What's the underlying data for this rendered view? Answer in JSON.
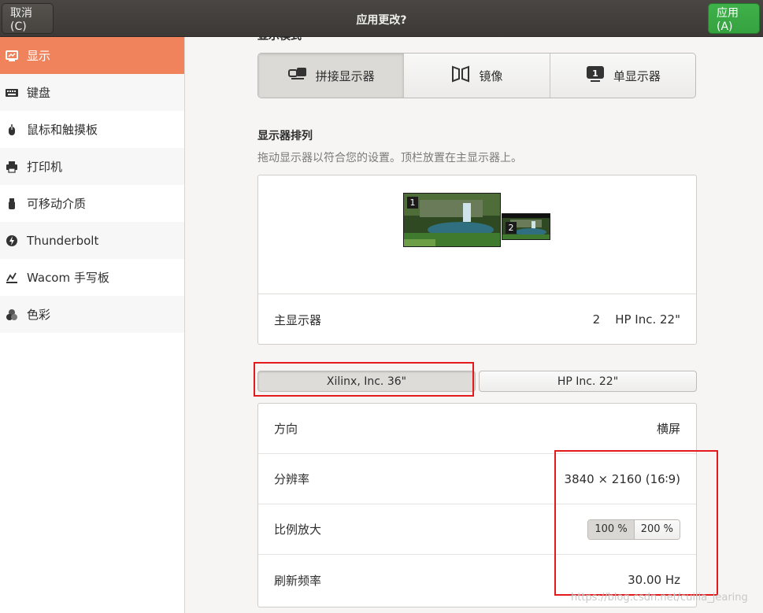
{
  "header": {
    "cancel_label": "取消(C)",
    "title": "应用更改?",
    "apply_label": "应用(A)"
  },
  "sidebar": {
    "items": [
      {
        "label": "显示",
        "icon": "display-icon"
      },
      {
        "label": "键盘",
        "icon": "keyboard-icon"
      },
      {
        "label": "鼠标和触摸板",
        "icon": "mouse-icon"
      },
      {
        "label": "打印机",
        "icon": "printer-icon"
      },
      {
        "label": "可移动介质",
        "icon": "removable-media-icon"
      },
      {
        "label": "Thunderbolt",
        "icon": "thunderbolt-icon"
      },
      {
        "label": "Wacom 手写板",
        "icon": "tablet-icon"
      },
      {
        "label": "色彩",
        "icon": "color-icon"
      }
    ]
  },
  "display_mode": {
    "title": "显示模式",
    "options": [
      "拼接显示器",
      "镜像",
      "单显示器"
    ],
    "selected": "拼接显示器"
  },
  "arrangement": {
    "title": "显示器排列",
    "description": "拖动显示器以符合您的设置。顶栏放置在主显示器上。",
    "monitor_numbers": [
      "1",
      "2"
    ],
    "primary_label": "主显示器",
    "primary_number": "2",
    "primary_name": "HP Inc. 22\""
  },
  "monitor_tabs": [
    "Xilinx, Inc. 36\"",
    "HP Inc. 22\""
  ],
  "settings": {
    "orientation_label": "方向",
    "orientation_value": "横屏",
    "resolution_label": "分辨率",
    "resolution_value": "3840 × 2160 (16∶9)",
    "scale_label": "比例放大",
    "scale_options": [
      "100 %",
      "200 %"
    ],
    "refresh_label": "刷新频率",
    "refresh_value": "30.00 Hz"
  },
  "watermark": "https://blog.csdn.net/cuilia_jearing",
  "colors": {
    "accent": "#f1835c",
    "apply": "#3fb04a",
    "highlight": "#e3191c"
  }
}
